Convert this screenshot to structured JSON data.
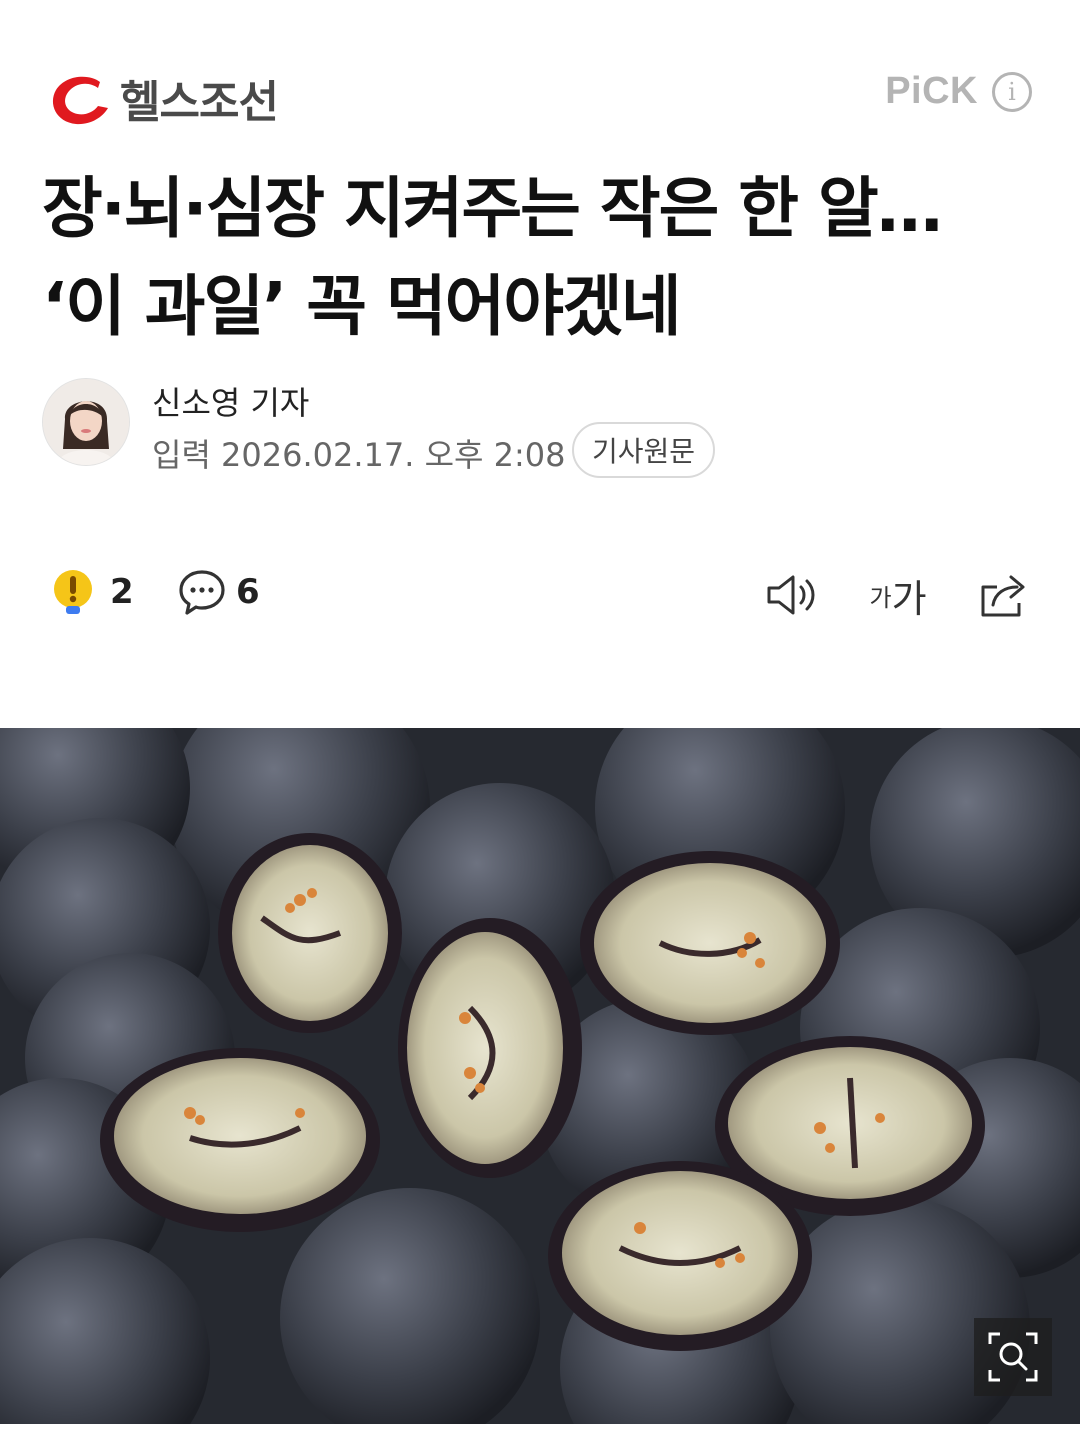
{
  "header": {
    "logo_text": "헬스조선",
    "pick_label": "PiCK",
    "logo_color": "#e0191f"
  },
  "article": {
    "headline": "장·뇌·심장 지켜주는 작은 한 알… ‘이 과일’ 꼭 먹어야겠네",
    "reporter": "신소영 기자",
    "published": "입력 2026.02.17. 오후 2:08",
    "origin_button": "기사원문"
  },
  "actions": {
    "reaction_count": "2",
    "comment_count": "6",
    "font_size_label_small": "가",
    "font_size_label_large": "가"
  },
  "photo": {
    "subject": "blueberries",
    "zoom_icon": "zoom-search-icon"
  }
}
